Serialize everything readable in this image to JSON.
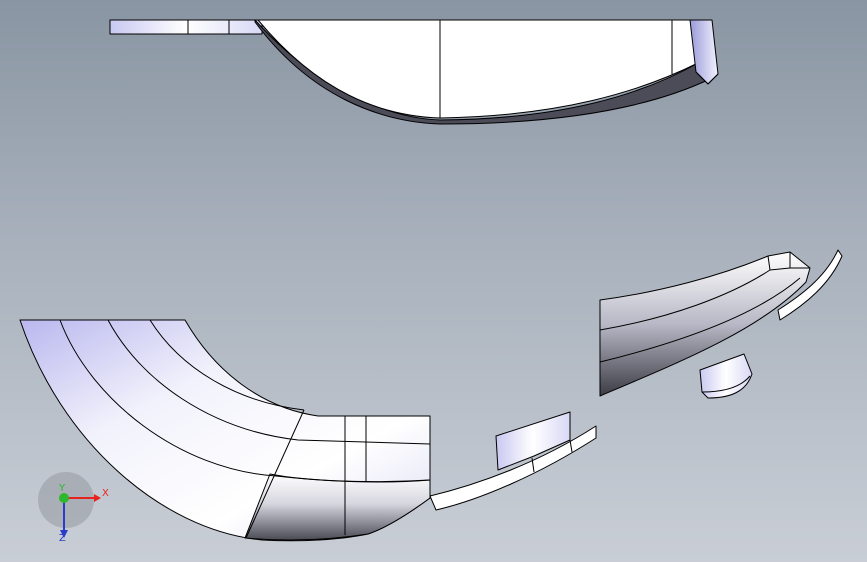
{
  "viewport": {
    "background_top": "#8a95a3",
    "background_bottom": "#c9ced6"
  },
  "triad": {
    "x_label": "X",
    "y_label": "Y",
    "z_label": "Z",
    "x_color": "#e8231f",
    "y_color": "#2db82d",
    "z_color": "#2a3cc8"
  },
  "parts": [
    {
      "name": "top-arc-profile"
    },
    {
      "name": "bottom-left-quarter-shell"
    },
    {
      "name": "bottom-center-strip"
    },
    {
      "name": "bottom-center-tab"
    },
    {
      "name": "right-curved-shell"
    },
    {
      "name": "right-small-curved-strip"
    },
    {
      "name": "right-small-fragment"
    }
  ]
}
